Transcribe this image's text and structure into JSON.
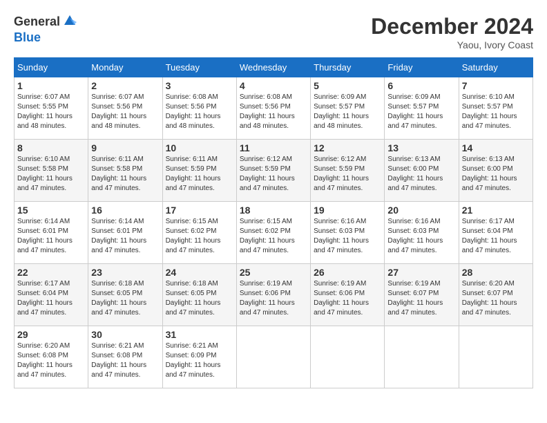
{
  "header": {
    "logo_line1": "General",
    "logo_line2": "Blue",
    "month_title": "December 2024",
    "location": "Yaou, Ivory Coast"
  },
  "weekdays": [
    "Sunday",
    "Monday",
    "Tuesday",
    "Wednesday",
    "Thursday",
    "Friday",
    "Saturday"
  ],
  "weeks": [
    [
      {
        "day": "1",
        "sunrise": "Sunrise: 6:07 AM",
        "sunset": "Sunset: 5:55 PM",
        "daylight": "Daylight: 11 hours and 48 minutes."
      },
      {
        "day": "2",
        "sunrise": "Sunrise: 6:07 AM",
        "sunset": "Sunset: 5:56 PM",
        "daylight": "Daylight: 11 hours and 48 minutes."
      },
      {
        "day": "3",
        "sunrise": "Sunrise: 6:08 AM",
        "sunset": "Sunset: 5:56 PM",
        "daylight": "Daylight: 11 hours and 48 minutes."
      },
      {
        "day": "4",
        "sunrise": "Sunrise: 6:08 AM",
        "sunset": "Sunset: 5:56 PM",
        "daylight": "Daylight: 11 hours and 48 minutes."
      },
      {
        "day": "5",
        "sunrise": "Sunrise: 6:09 AM",
        "sunset": "Sunset: 5:57 PM",
        "daylight": "Daylight: 11 hours and 48 minutes."
      },
      {
        "day": "6",
        "sunrise": "Sunrise: 6:09 AM",
        "sunset": "Sunset: 5:57 PM",
        "daylight": "Daylight: 11 hours and 47 minutes."
      },
      {
        "day": "7",
        "sunrise": "Sunrise: 6:10 AM",
        "sunset": "Sunset: 5:57 PM",
        "daylight": "Daylight: 11 hours and 47 minutes."
      }
    ],
    [
      {
        "day": "8",
        "sunrise": "Sunrise: 6:10 AM",
        "sunset": "Sunset: 5:58 PM",
        "daylight": "Daylight: 11 hours and 47 minutes."
      },
      {
        "day": "9",
        "sunrise": "Sunrise: 6:11 AM",
        "sunset": "Sunset: 5:58 PM",
        "daylight": "Daylight: 11 hours and 47 minutes."
      },
      {
        "day": "10",
        "sunrise": "Sunrise: 6:11 AM",
        "sunset": "Sunset: 5:59 PM",
        "daylight": "Daylight: 11 hours and 47 minutes."
      },
      {
        "day": "11",
        "sunrise": "Sunrise: 6:12 AM",
        "sunset": "Sunset: 5:59 PM",
        "daylight": "Daylight: 11 hours and 47 minutes."
      },
      {
        "day": "12",
        "sunrise": "Sunrise: 6:12 AM",
        "sunset": "Sunset: 5:59 PM",
        "daylight": "Daylight: 11 hours and 47 minutes."
      },
      {
        "day": "13",
        "sunrise": "Sunrise: 6:13 AM",
        "sunset": "Sunset: 6:00 PM",
        "daylight": "Daylight: 11 hours and 47 minutes."
      },
      {
        "day": "14",
        "sunrise": "Sunrise: 6:13 AM",
        "sunset": "Sunset: 6:00 PM",
        "daylight": "Daylight: 11 hours and 47 minutes."
      }
    ],
    [
      {
        "day": "15",
        "sunrise": "Sunrise: 6:14 AM",
        "sunset": "Sunset: 6:01 PM",
        "daylight": "Daylight: 11 hours and 47 minutes."
      },
      {
        "day": "16",
        "sunrise": "Sunrise: 6:14 AM",
        "sunset": "Sunset: 6:01 PM",
        "daylight": "Daylight: 11 hours and 47 minutes."
      },
      {
        "day": "17",
        "sunrise": "Sunrise: 6:15 AM",
        "sunset": "Sunset: 6:02 PM",
        "daylight": "Daylight: 11 hours and 47 minutes."
      },
      {
        "day": "18",
        "sunrise": "Sunrise: 6:15 AM",
        "sunset": "Sunset: 6:02 PM",
        "daylight": "Daylight: 11 hours and 47 minutes."
      },
      {
        "day": "19",
        "sunrise": "Sunrise: 6:16 AM",
        "sunset": "Sunset: 6:03 PM",
        "daylight": "Daylight: 11 hours and 47 minutes."
      },
      {
        "day": "20",
        "sunrise": "Sunrise: 6:16 AM",
        "sunset": "Sunset: 6:03 PM",
        "daylight": "Daylight: 11 hours and 47 minutes."
      },
      {
        "day": "21",
        "sunrise": "Sunrise: 6:17 AM",
        "sunset": "Sunset: 6:04 PM",
        "daylight": "Daylight: 11 hours and 47 minutes."
      }
    ],
    [
      {
        "day": "22",
        "sunrise": "Sunrise: 6:17 AM",
        "sunset": "Sunset: 6:04 PM",
        "daylight": "Daylight: 11 hours and 47 minutes."
      },
      {
        "day": "23",
        "sunrise": "Sunrise: 6:18 AM",
        "sunset": "Sunset: 6:05 PM",
        "daylight": "Daylight: 11 hours and 47 minutes."
      },
      {
        "day": "24",
        "sunrise": "Sunrise: 6:18 AM",
        "sunset": "Sunset: 6:05 PM",
        "daylight": "Daylight: 11 hours and 47 minutes."
      },
      {
        "day": "25",
        "sunrise": "Sunrise: 6:19 AM",
        "sunset": "Sunset: 6:06 PM",
        "daylight": "Daylight: 11 hours and 47 minutes."
      },
      {
        "day": "26",
        "sunrise": "Sunrise: 6:19 AM",
        "sunset": "Sunset: 6:06 PM",
        "daylight": "Daylight: 11 hours and 47 minutes."
      },
      {
        "day": "27",
        "sunrise": "Sunrise: 6:19 AM",
        "sunset": "Sunset: 6:07 PM",
        "daylight": "Daylight: 11 hours and 47 minutes."
      },
      {
        "day": "28",
        "sunrise": "Sunrise: 6:20 AM",
        "sunset": "Sunset: 6:07 PM",
        "daylight": "Daylight: 11 hours and 47 minutes."
      }
    ],
    [
      {
        "day": "29",
        "sunrise": "Sunrise: 6:20 AM",
        "sunset": "Sunset: 6:08 PM",
        "daylight": "Daylight: 11 hours and 47 minutes."
      },
      {
        "day": "30",
        "sunrise": "Sunrise: 6:21 AM",
        "sunset": "Sunset: 6:08 PM",
        "daylight": "Daylight: 11 hours and 47 minutes."
      },
      {
        "day": "31",
        "sunrise": "Sunrise: 6:21 AM",
        "sunset": "Sunset: 6:09 PM",
        "daylight": "Daylight: 11 hours and 47 minutes."
      },
      null,
      null,
      null,
      null
    ]
  ]
}
